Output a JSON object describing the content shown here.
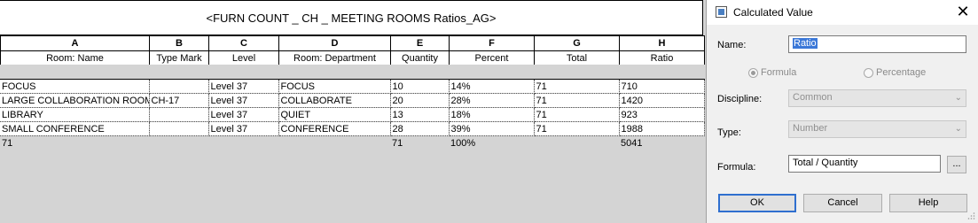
{
  "schedule": {
    "title": "<FURN COUNT _ CH _  MEETING ROOMS Ratios_AG>",
    "column_letters": [
      "A",
      "B",
      "C",
      "D",
      "E",
      "F",
      "G",
      "H"
    ],
    "column_names": [
      "Room: Name",
      "Type Mark",
      "Level",
      "Room: Department",
      "Quantity",
      "Percent",
      "Total",
      "Ratio"
    ],
    "rows": [
      [
        "FOCUS",
        "",
        "Level 37",
        "FOCUS",
        "10",
        "14%",
        "71",
        "710"
      ],
      [
        "LARGE COLLABORATION ROOM",
        "CH-17",
        "Level 37",
        "COLLABORATE",
        "20",
        "28%",
        "71",
        "1420"
      ],
      [
        "LIBRARY",
        "",
        "Level 37",
        "QUIET",
        "13",
        "18%",
        "71",
        "923"
      ],
      [
        "SMALL CONFERENCE",
        "",
        "Level 37",
        "CONFERENCE",
        "28",
        "39%",
        "71",
        "1988"
      ]
    ],
    "totals": [
      "71",
      "",
      "",
      "",
      "71",
      "100%",
      "",
      "5041"
    ]
  },
  "dialog": {
    "title": "Calculated Value",
    "close_glyph": "✕",
    "name_label": "Name:",
    "name_value": "Ratio",
    "radio_formula": "Formula",
    "radio_percentage": "Percentage",
    "discipline_label": "Discipline:",
    "discipline_value": "Common",
    "type_label": "Type:",
    "type_value": "Number",
    "formula_label": "Formula:",
    "formula_value": "Total / Quantity",
    "ellipsis": "...",
    "ok": "OK",
    "cancel": "Cancel",
    "help": "Help"
  }
}
